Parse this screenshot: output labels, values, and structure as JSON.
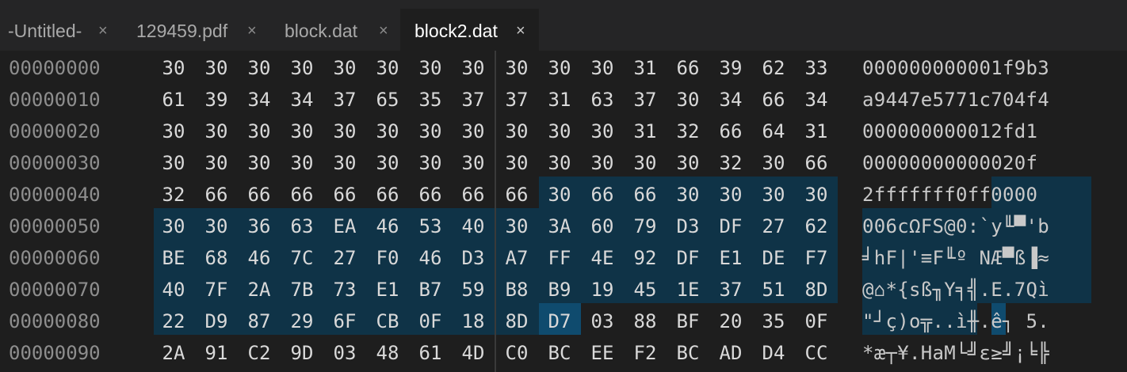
{
  "tabs": [
    {
      "label": "-Untitled-",
      "active": false
    },
    {
      "label": "129459.pdf",
      "active": false
    },
    {
      "label": "block.dat",
      "active": false
    },
    {
      "label": "block2.dat",
      "active": true
    }
  ],
  "close_glyph": "×",
  "selection_color": "#0f3347",
  "cursor_color": "#0f4b6e",
  "rows": [
    {
      "address": "00000000",
      "bytes": [
        "30",
        "30",
        "30",
        "30",
        "30",
        "30",
        "30",
        "30",
        "30",
        "30",
        "30",
        "31",
        "66",
        "39",
        "62",
        "33"
      ],
      "ascii": "000000000001f9b3"
    },
    {
      "address": "00000010",
      "bytes": [
        "61",
        "39",
        "34",
        "34",
        "37",
        "65",
        "35",
        "37",
        "37",
        "31",
        "63",
        "37",
        "30",
        "34",
        "66",
        "34"
      ],
      "ascii": "a9447e5771c704f4"
    },
    {
      "address": "00000020",
      "bytes": [
        "30",
        "30",
        "30",
        "30",
        "30",
        "30",
        "30",
        "30",
        "30",
        "30",
        "30",
        "31",
        "32",
        "66",
        "64",
        "31"
      ],
      "ascii": "000000000012fd1"
    },
    {
      "address": "00000030",
      "bytes": [
        "30",
        "30",
        "30",
        "30",
        "30",
        "30",
        "30",
        "30",
        "30",
        "30",
        "30",
        "30",
        "30",
        "32",
        "30",
        "66"
      ],
      "ascii": "00000000000020f"
    },
    {
      "address": "00000040",
      "bytes": [
        "32",
        "66",
        "66",
        "66",
        "66",
        "66",
        "66",
        "66",
        "66",
        "30",
        "66",
        "66",
        "30",
        "30",
        "30",
        "30"
      ],
      "ascii": "2fffffff0ff0000"
    },
    {
      "address": "00000050",
      "bytes": [
        "30",
        "30",
        "36",
        "63",
        "EA",
        "46",
        "53",
        "40",
        "30",
        "3A",
        "60",
        "79",
        "D3",
        "DF",
        "27",
        "62"
      ],
      "ascii": "006cΩFS@0:`y╙▀'b"
    },
    {
      "address": "00000060",
      "bytes": [
        "BE",
        "68",
        "46",
        "7C",
        "27",
        "F0",
        "46",
        "D3",
        "A7",
        "FF",
        "4E",
        "92",
        "DF",
        "E1",
        "DE",
        "F7"
      ],
      "ascii": "╛hF|'≡F╙º NÆ▀ß▐≈"
    },
    {
      "address": "00000070",
      "bytes": [
        "40",
        "7F",
        "2A",
        "7B",
        "73",
        "E1",
        "B7",
        "59",
        "B8",
        "B9",
        "19",
        "45",
        "1E",
        "37",
        "51",
        "8D"
      ],
      "ascii": "@⌂*{sß╖Y╕╣.E.7Qì"
    },
    {
      "address": "00000080",
      "bytes": [
        "22",
        "D9",
        "87",
        "29",
        "6F",
        "CB",
        "0F",
        "18",
        "8D",
        "D7",
        "03",
        "88",
        "BF",
        "20",
        "35",
        "0F"
      ],
      "ascii": "\"┘ç)o╦..ì╫.ê┐ 5."
    },
    {
      "address": "00000090",
      "bytes": [
        "2A",
        "91",
        "C2",
        "9D",
        "03",
        "48",
        "61",
        "4D",
        "C0",
        "BC",
        "EE",
        "F2",
        "BC",
        "AD",
        "D4",
        "CC"
      ],
      "ascii": "*æ┬¥.HaM└╝ε≥╝¡╘╠"
    }
  ]
}
